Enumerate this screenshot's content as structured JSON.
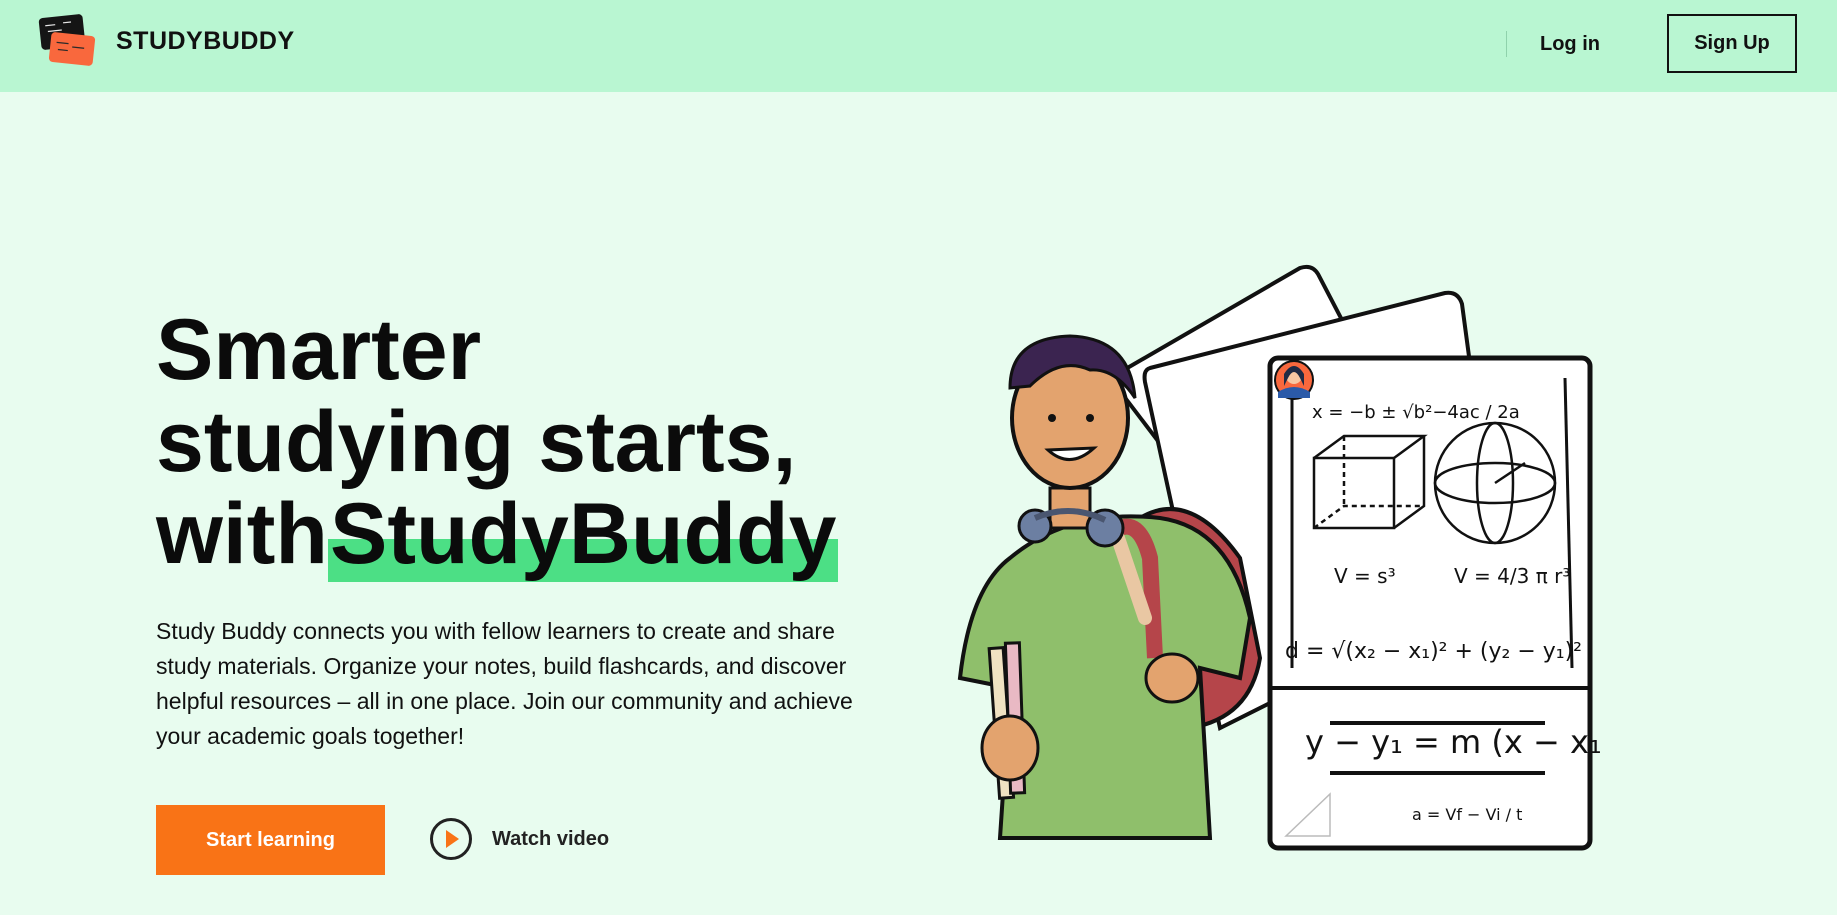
{
  "header": {
    "brand_name": "STUDYBUDDY",
    "login_label": "Log in",
    "signup_label": "Sign Up"
  },
  "hero": {
    "title_line1": "Smarter",
    "title_line2": "studying starts,",
    "title_with": "with",
    "title_highlight": "StudyBuddy",
    "description": "Study Buddy connects you with fellow learners to create and share study materials. Organize your notes, build flashcards, and discover helpful resources – all in one place. Join our community and achieve your academic goals together!",
    "start_label": "Start learning",
    "watch_label": "Watch video"
  },
  "illustration": {
    "formula_quadratic": "x = −b ± √b²−4ac / 2a",
    "formula_cube": "V = s³",
    "formula_sphere": "V = 4/3 π r³",
    "formula_distance": "d = √(x₂ − x₁)² + (y₂ − y₁)²",
    "formula_line": "y − y₁ = m (x − x₁)",
    "formula_accel": "a = Vf − Vi / t"
  },
  "colors": {
    "header_bg": "#b9f6d2",
    "page_bg": "#e8fcef",
    "accent": "#f97316",
    "highlight": "#4cdf85"
  }
}
